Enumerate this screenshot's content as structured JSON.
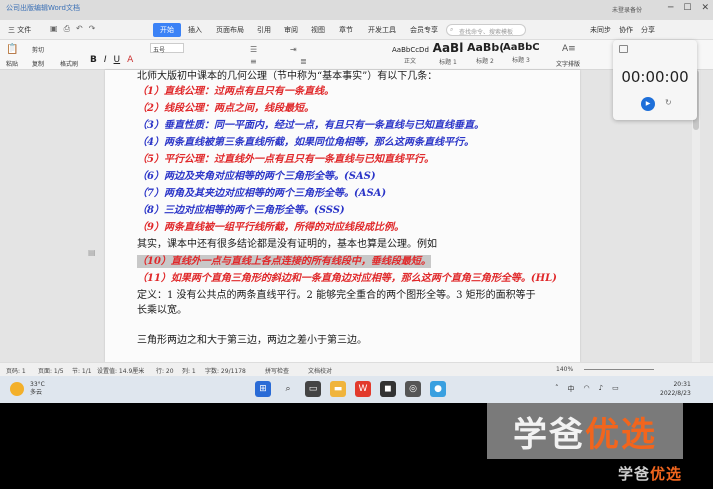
{
  "window": {
    "title": "公司出版编辑Word文档",
    "sync_status": "未登录备份"
  },
  "menu": {
    "file": "三 文件",
    "tabs": [
      "开始",
      "插入",
      "页面布局",
      "引用",
      "审阅",
      "视图",
      "章节",
      "开发工具",
      "会员专享"
    ],
    "search_placeholder": "查找命令、搜索模板",
    "right_tools": [
      "未同步",
      "协作",
      "分享"
    ]
  },
  "ribbon": {
    "paste": "粘贴",
    "cut": "剪切",
    "copy": "复制",
    "format_painter": "格式刷",
    "font_size": "五号",
    "format_buttons": [
      "B",
      "I",
      "U",
      "A"
    ],
    "styles": [
      {
        "preview": "AaBbCcDd",
        "label": "正文"
      },
      {
        "preview": "AaBl",
        "label": "标题 1"
      },
      {
        "preview": "AaBb(",
        "label": "标题 2"
      },
      {
        "preview": "AaBbC",
        "label": "标题 3"
      }
    ],
    "text_tools": "文字排版"
  },
  "document": {
    "lines": [
      {
        "text": "北师大版初中课本的几何公理（节中称为“基本事实”）有以下几条：",
        "style": "black"
      },
      {
        "text": "（1）直线公理：过两点有且只有一条直线。",
        "style": "red"
      },
      {
        "text": "（2）线段公理：两点之间，线段最短。",
        "style": "red"
      },
      {
        "text": "（3）垂直性质：同一平面内，经过一点，有且只有一条直线与已知直线垂直。",
        "style": "blue"
      },
      {
        "text": "（4）两条直线被第三条直线所截，如果同位角相等，那么这两条直线平行。",
        "style": "blue"
      },
      {
        "text": "（5）平行公理：过直线外一点有且只有一条直线与已知直线平行。",
        "style": "red"
      },
      {
        "text": "（6）两边及夹角对应相等的两个三角形全等。(SAS)",
        "style": "blue"
      },
      {
        "text": "（7）两角及其夹边对应相等的两个三角形全等。(ASA)",
        "style": "blue"
      },
      {
        "text": "（8）三边对应相等的两个三角形全等。(SSS)",
        "style": "blue"
      },
      {
        "text": "（9）两条直线被一组平行线所截，所得的对应线段成比例。",
        "style": "red"
      },
      {
        "text": "其实，课本中还有很多结论都是没有证明的，基本也算是公理。例如",
        "style": "black"
      },
      {
        "text": "（10）直线外一点与直线上各点连接的所有线段中，垂线段最短。",
        "style": "red-hl"
      },
      {
        "text": "（11）如果两个直角三角形的斜边和一条直角边对应相等，那么这两个直角三角形全等。(HL)",
        "style": "red"
      },
      {
        "text": "定义：1 没有公共点的两条直线平行。2 能够完全重合的两个图形全等。3 矩形的面积等于",
        "style": "black"
      },
      {
        "text": "长乘以宽。",
        "style": "black"
      },
      {
        "text": "",
        "style": "black"
      },
      {
        "text": "三角形两边之和大于第三边，两边之差小于第三边。",
        "style": "black"
      }
    ]
  },
  "status": {
    "items": [
      "页码: 1",
      "页面: 1/5",
      "节: 1/1",
      "设置值: 14.9厘米",
      "行: 20",
      "列: 1",
      "字数: 29/1178",
      "拼写检查",
      "文档校对"
    ],
    "zoom": "140%"
  },
  "taskbar": {
    "temperature": "33°C",
    "weather": "多云",
    "time": "20:31",
    "date": "2022/8/23",
    "ime": "中"
  },
  "recorder": {
    "timer": "00:00:00"
  },
  "watermark": {
    "text_main": "学爸",
    "text_accent": "优选"
  },
  "colors": {
    "accent": "#3b82f6",
    "red_text": "#e0282a",
    "blue_text": "#2b35c8",
    "watermark_accent": "#f2651d"
  }
}
